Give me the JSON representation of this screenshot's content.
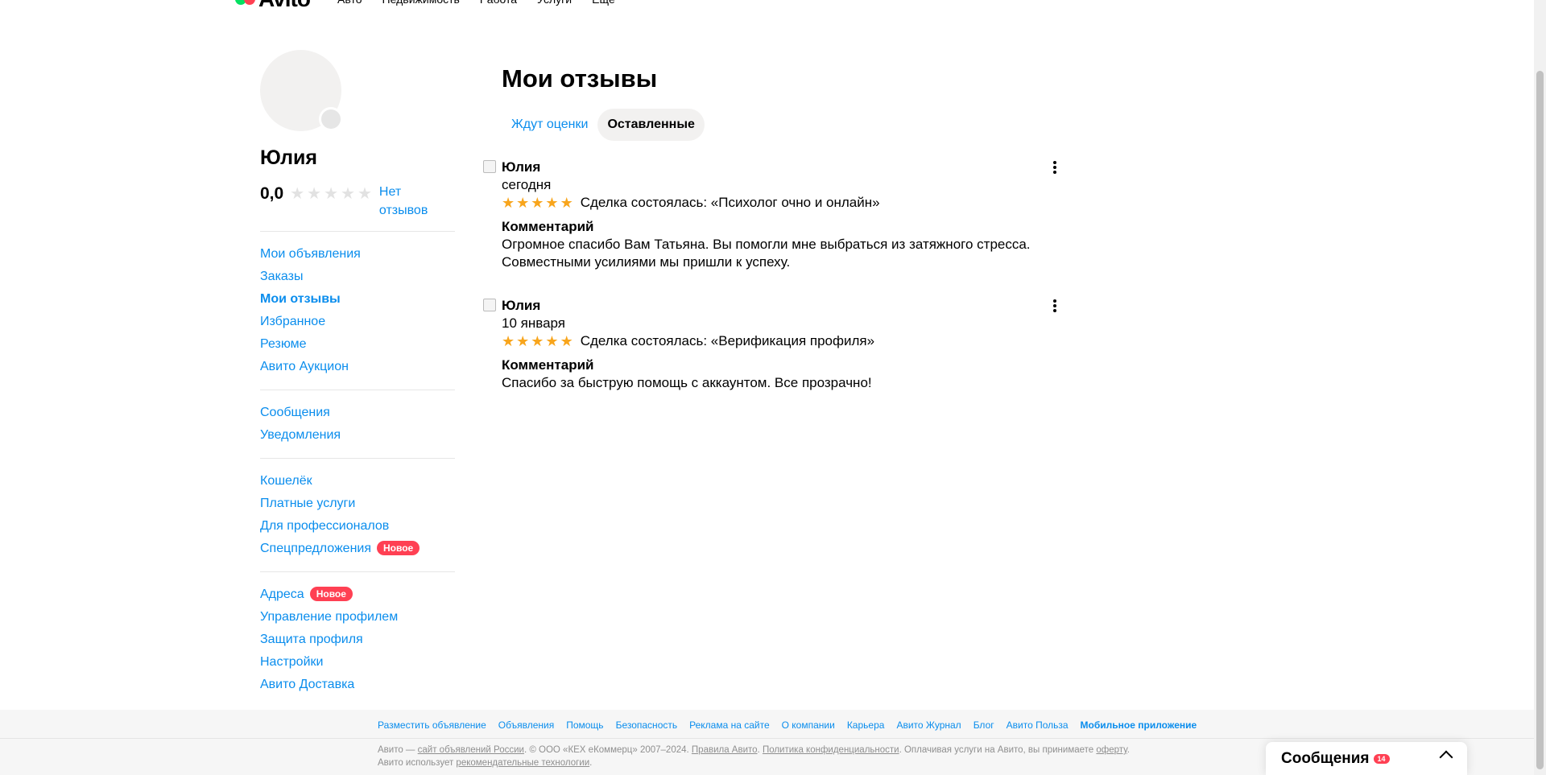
{
  "topnav": {
    "logo_text": "Avito",
    "links": [
      "Авто",
      "Недвижимость",
      "Работа",
      "Услуги",
      "Ещё"
    ]
  },
  "sidebar": {
    "name": "Юлия",
    "rating": "0,0",
    "no_reviews": "Нет отзывов",
    "groups": [
      [
        {
          "label": "Мои объявления"
        },
        {
          "label": "Заказы"
        },
        {
          "label": "Мои отзывы",
          "active": true
        },
        {
          "label": "Избранное"
        },
        {
          "label": "Резюме"
        },
        {
          "label": "Авито Аукцион"
        }
      ],
      [
        {
          "label": "Сообщения"
        },
        {
          "label": "Уведомления"
        }
      ],
      [
        {
          "label": "Кошелёк"
        },
        {
          "label": "Платные услуги"
        },
        {
          "label": "Для профессионалов"
        },
        {
          "label": "Спецпредложения",
          "badge": "Новое"
        }
      ],
      [
        {
          "label": "Адреса",
          "badge": "Новое"
        },
        {
          "label": "Управление профилем"
        },
        {
          "label": "Защита профиля"
        },
        {
          "label": "Настройки"
        },
        {
          "label": "Авито Доставка"
        }
      ]
    ]
  },
  "main": {
    "title": "Мои отзывы",
    "tabs": [
      {
        "label": "Ждут оценки",
        "active": false
      },
      {
        "label": "Оставленные",
        "active": true
      }
    ],
    "reviews": [
      {
        "author": "Юлия",
        "date": "сегодня",
        "stars": 5,
        "deal": "Сделка состоялась: «Психолог очно и онлайн»",
        "comment_title": "Комментарий",
        "comment": "Огромное спасибо Вам Татьяна. Вы помогли мне выбраться из затяжного стресса. Совместными усилиями мы пришли к успеху."
      },
      {
        "author": "Юлия",
        "date": "10 января",
        "stars": 5,
        "deal": "Сделка состоялась: «Верификация профиля»",
        "comment_title": "Комментарий",
        "comment": "Спасибо за быструю помощь с аккаунтом. Все прозрачно!"
      }
    ]
  },
  "footer": {
    "links": [
      {
        "label": "Разместить объявление"
      },
      {
        "label": "Объявления"
      },
      {
        "label": "Помощь"
      },
      {
        "label": "Безопасность"
      },
      {
        "label": "Реклама на сайте"
      },
      {
        "label": "О компании"
      },
      {
        "label": "Карьера"
      },
      {
        "label": "Авито Журнал"
      },
      {
        "label": "Блог"
      },
      {
        "label": "Авито Польза"
      },
      {
        "label": "Мобильное приложение",
        "bold": true
      }
    ],
    "legal": {
      "t1": "Авито — ",
      "u1": "сайт объявлений России",
      "t2": ". © ООО «КЕХ еКоммерц» 2007–2024. ",
      "u2": "Правила Авито",
      "t3": ". ",
      "u3": "Политика конфиденциальности",
      "t4": ". Оплачивая услуги на Авито, вы принимаете ",
      "u4": "оферту",
      "t5": ". Авито использует ",
      "u5": "рекомендательные технологии",
      "t6": "."
    }
  },
  "messages_widget": {
    "label": "Сообщения",
    "count": "14"
  },
  "colors": {
    "link": "#0a8ded",
    "star": "#f8a51c",
    "badge": "#ff4053"
  }
}
